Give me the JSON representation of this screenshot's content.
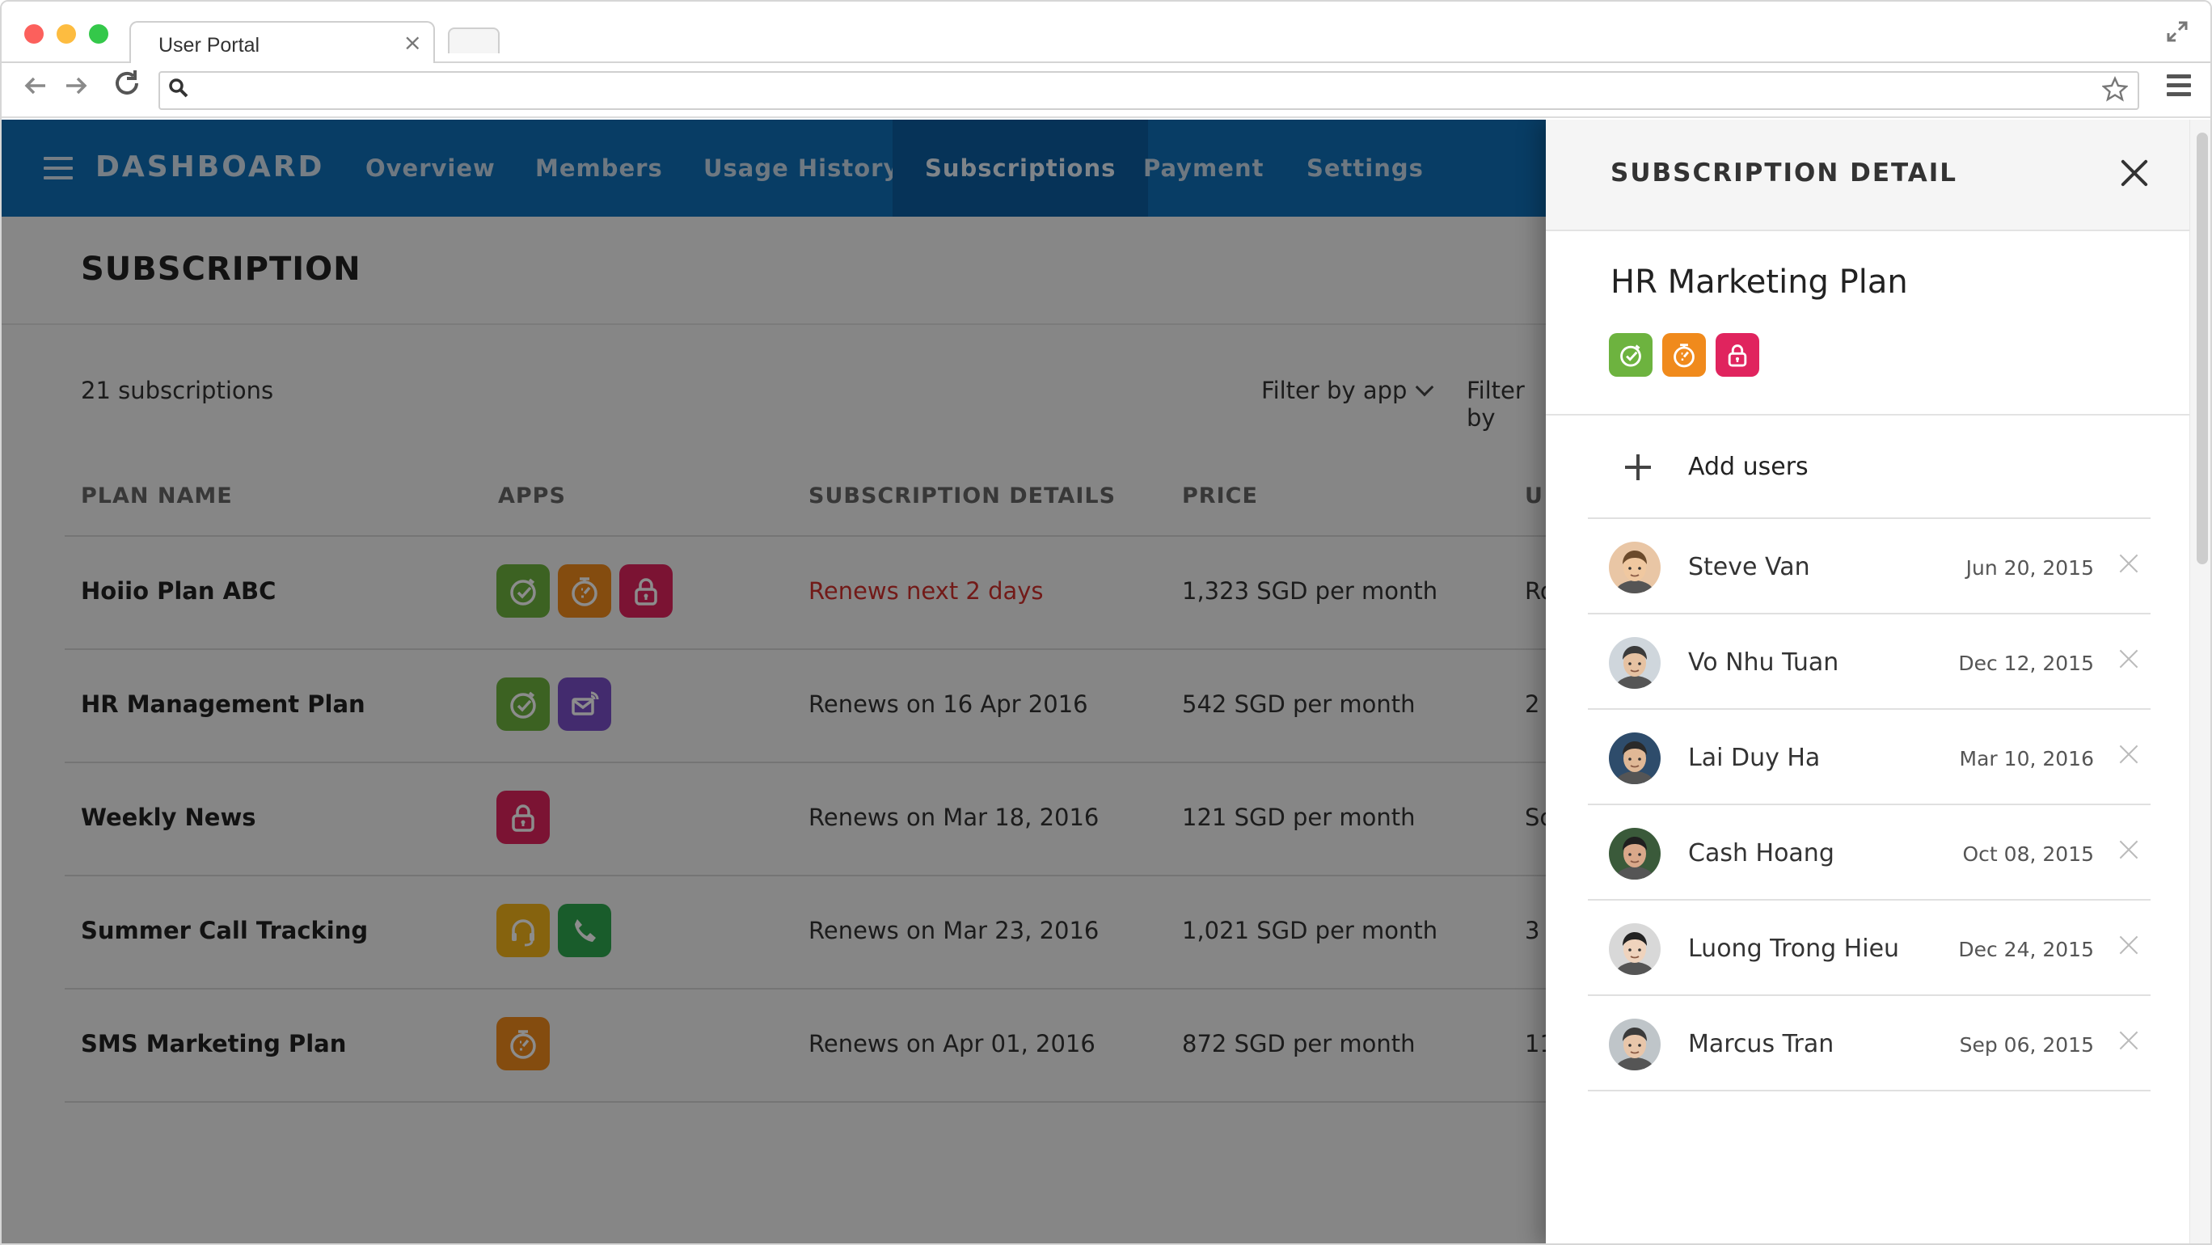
{
  "browser": {
    "tab_title": "User Portal",
    "tab_close": "×",
    "address": "",
    "icons": [
      "back-arrow-icon",
      "forward-arrow-icon",
      "reload-icon",
      "search-icon",
      "star-icon",
      "menu-icon",
      "fullscreen-icon"
    ]
  },
  "header": {
    "brand": "DASHBOARD",
    "nav": [
      {
        "label": "Overview"
      },
      {
        "label": "Members"
      },
      {
        "label": "Usage History"
      },
      {
        "label": "Subscriptions",
        "active": true
      },
      {
        "label": "Payment"
      },
      {
        "label": "Settings"
      }
    ],
    "accent_color": "#0f6fb8"
  },
  "main": {
    "title": "SUBSCRIPTION",
    "count": "21 subscriptions",
    "filter_app": "Filter by app",
    "filter_2": "Filter by",
    "columns": [
      "PLAN NAME",
      "APPS",
      "SUBSCRIPTION DETAILS",
      "PRICE",
      "U"
    ],
    "rows": [
      {
        "name": "Hoiio Plan ABC",
        "apps": [
          "timer-green",
          "stopwatch-orange",
          "lock-red"
        ],
        "details": "Renews next 2 days",
        "details_warn": true,
        "price": "1,323 SGD per month",
        "users": "Ro"
      },
      {
        "name": "HR Management Plan",
        "apps": [
          "timer-green",
          "mail-purple"
        ],
        "details": "Renews on 16 Apr 2016",
        "price": "542 SGD per month",
        "users": "2"
      },
      {
        "name": "Weekly News",
        "apps": [
          "lock-red"
        ],
        "details": "Renews on Mar 18, 2016",
        "price": "121 SGD per month",
        "users": "Sc"
      },
      {
        "name": "Summer Call Tracking",
        "apps": [
          "headset-yellow",
          "phone-green"
        ],
        "details": "Renews on Mar 23, 2016",
        "price": "1,021 SGD per month",
        "users": "3"
      },
      {
        "name": "SMS Marketing Plan",
        "apps": [
          "stopwatch-orange"
        ],
        "details": "Renews on Apr 01, 2016",
        "price": "872 SGD per month",
        "users": "11"
      }
    ]
  },
  "panel": {
    "title": "SUBSCRIPTION DETAIL",
    "plan_name": "HR Marketing Plan",
    "plan_apps": [
      "timer-green",
      "stopwatch-orange",
      "lock-red"
    ],
    "add_users_label": "Add users",
    "users": [
      {
        "name": "Steve Van",
        "date": "Jun 20, 2015"
      },
      {
        "name": "Vo Nhu Tuan",
        "date": "Dec 12, 2015"
      },
      {
        "name": "Lai Duy Ha",
        "date": "Mar 10, 2016"
      },
      {
        "name": "Cash Hoang",
        "date": "Oct 08, 2015"
      },
      {
        "name": "Luong Trong Hieu",
        "date": "Dec 24, 2015"
      },
      {
        "name": "Marcus Tran",
        "date": "Sep 06, 2015"
      }
    ]
  },
  "colors": {
    "timer-green": "#6db33f",
    "stopwatch-orange": "#f08a1c",
    "lock-red": "#e0245e",
    "mail-purple": "#7a4fc9",
    "headset-yellow": "#f5b51b",
    "phone-green": "#2fa84f",
    "warn": "#d0312d"
  }
}
